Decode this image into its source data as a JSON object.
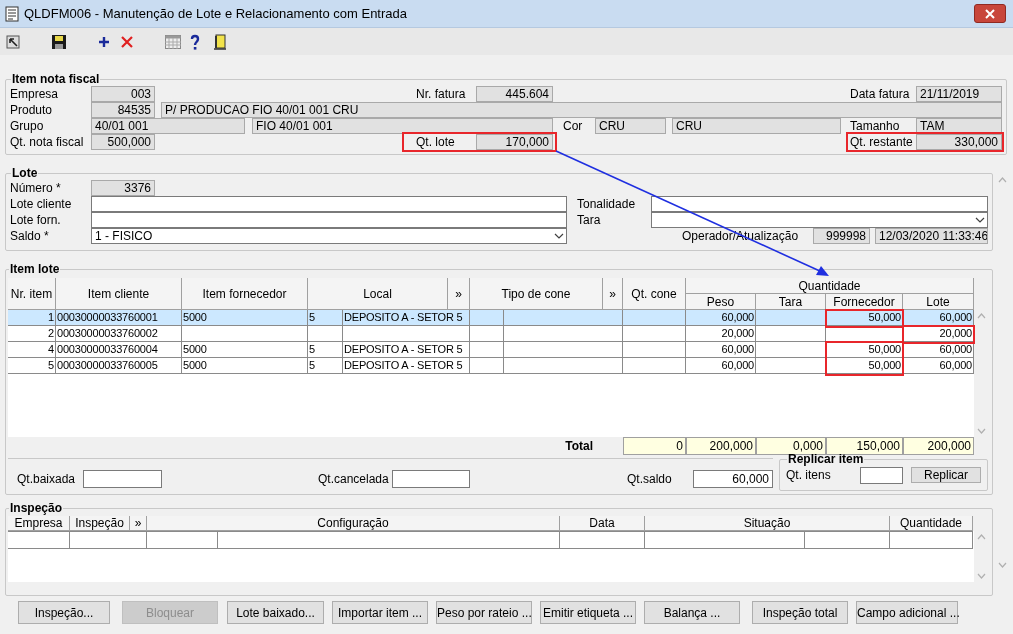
{
  "window": {
    "title": "QLDFM006 - Manutenção de Lote e Relacionamento com Entrada"
  },
  "item_nota_fiscal": {
    "title": "Item nota fiscal",
    "empresa": {
      "label": "Empresa",
      "value": "003"
    },
    "nr_fatura": {
      "label": "Nr. fatura",
      "value": "445.604"
    },
    "data_fatura": {
      "label": "Data fatura",
      "value": "21/11/2019"
    },
    "produto": {
      "label": "Produto",
      "code": "84535",
      "description": "P/ PRODUCAO FIO 40/01 001 CRU"
    },
    "grupo": {
      "label": "Grupo",
      "code": "40/01 001",
      "description": "FIO 40/01 001"
    },
    "cor": {
      "label": "Cor",
      "code": "CRU",
      "description": "CRU"
    },
    "tamanho": {
      "label": "Tamanho",
      "value": "TAM"
    },
    "qt_nota_fiscal": {
      "label": "Qt. nota fiscal",
      "value": "500,000"
    },
    "qt_lote": {
      "label": "Qt. lote",
      "value": "170,000"
    },
    "qt_restante": {
      "label": "Qt. restante",
      "value": "330,000"
    }
  },
  "lote": {
    "title": "Lote",
    "numero": {
      "label": "Número *",
      "value": "3376"
    },
    "lote_cliente": {
      "label": "Lote cliente"
    },
    "tonalidade": {
      "label": "Tonalidade"
    },
    "lote_forn": {
      "label": "Lote forn."
    },
    "tara": {
      "label": "Tara"
    },
    "saldo": {
      "label": "Saldo *",
      "value": "1 - FISICO"
    },
    "operador": {
      "label": "Operador/Atualização",
      "code": "999998",
      "timestamp": "12/03/2020 11:33:46"
    }
  },
  "item_lote": {
    "title": "Item lote",
    "columns": [
      "Nr. item",
      "Item cliente",
      "Item fornecedor",
      "Local",
      "»",
      "Tipo de cone",
      "»",
      "Qt. cone"
    ],
    "quantity_group": "Quantidade",
    "quantity_columns": [
      "Peso",
      "Tara",
      "Fornecedor",
      "Lote"
    ],
    "rows": [
      {
        "nr": "1",
        "item_cliente": "00030000033760001",
        "item_fornecedor": "5000",
        "local_code": "5",
        "local_name": "DEPOSITO A - SETOR 5",
        "peso": "60,000",
        "fornecedor": "50,000",
        "lote": "60,000",
        "selected": true
      },
      {
        "nr": "2",
        "item_cliente": "00030000033760002",
        "peso": "20,000",
        "lote": "20,000",
        "selected": false
      },
      {
        "nr": "4",
        "item_cliente": "00030000033760004",
        "item_fornecedor": "5000",
        "local_code": "5",
        "local_name": "DEPOSITO A - SETOR 5",
        "peso": "60,000",
        "fornecedor": "50,000",
        "lote": "60,000",
        "selected": false
      },
      {
        "nr": "5",
        "item_cliente": "00030000033760005",
        "item_fornecedor": "5000",
        "local_code": "5",
        "local_name": "DEPOSITO A - SETOR 5",
        "peso": "60,000",
        "fornecedor": "50,000",
        "lote": "60,000",
        "selected": false
      }
    ],
    "total": {
      "label": "Total",
      "values": [
        "0",
        "200,000",
        "0,000",
        "150,000",
        "200,000"
      ]
    },
    "qt_baixada": {
      "label": "Qt.baixada"
    },
    "qt_cancelada": {
      "label": "Qt.cancelada"
    },
    "qt_saldo": {
      "label": "Qt.saldo",
      "value": "60,000"
    },
    "replicar": {
      "title": "Replicar item",
      "label": "Qt. itens",
      "button": "Replicar"
    }
  },
  "inspecao": {
    "title": "Inspeção",
    "columns": [
      "Empresa",
      "Inspeção",
      "»",
      "Configuração",
      "Data",
      "Situação",
      "Quantidade"
    ]
  },
  "buttons": [
    {
      "label": "Inspeção...",
      "disabled": false
    },
    {
      "label": "Bloquear",
      "disabled": true
    },
    {
      "label": "Lote baixado...",
      "disabled": false
    },
    {
      "label": "Importar item ...",
      "disabled": false
    },
    {
      "label": "Peso por rateio ...",
      "disabled": false
    },
    {
      "label": "Emitir etiqueta ...",
      "disabled": false
    },
    {
      "label": "Balança ...",
      "disabled": false
    },
    {
      "label": "Inspeção total",
      "disabled": false
    },
    {
      "label": "Campo adicional ...",
      "disabled": false
    }
  ]
}
